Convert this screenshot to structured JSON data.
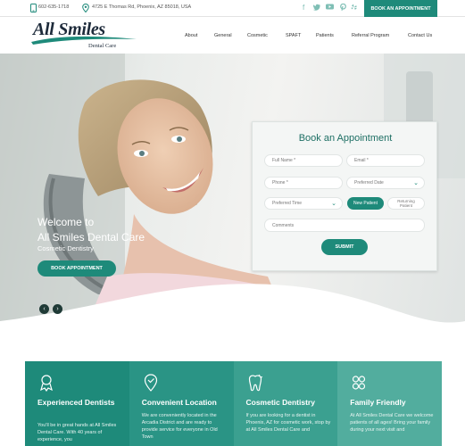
{
  "topbar": {
    "phone": "602-635-1718",
    "address": "4725 E Thomas Rd, Phoenix, AZ 85018, USA",
    "social_icons": [
      "facebook-icon",
      "twitter-icon",
      "youtube-icon",
      "pinterest-icon",
      "yelp-icon"
    ],
    "book_label": "BOOK AN APPOINTMENT"
  },
  "logo": {
    "main": "All Smiles",
    "sub": "Dental Care"
  },
  "nav": [
    "About",
    "General",
    "Cosmetic",
    "SPAFT",
    "Patients",
    "Referral Program",
    "Contact Us"
  ],
  "hero": {
    "line1": "Welcome to",
    "line2": "All Smiles Dental Care",
    "tagline": "Cosmetic Dentistry",
    "button": "BOOK APPOINTMENT",
    "prev": "‹",
    "next": "›"
  },
  "form": {
    "title": "Book an Appointment",
    "full_name": "Full Name *",
    "email": "Email *",
    "phone": "Phone *",
    "preferred_date": "Preferred Date",
    "preferred_time": "Preferred Time",
    "new_patient": "New Patient",
    "returning_patient": "Returning Patient",
    "comments": "Comments",
    "submit": "SUBMIT"
  },
  "features": [
    {
      "title": "Experienced Dentists",
      "body": "You'll be in great hands at All Smiles Dental Care. With 40 years of experience, you",
      "color": "#1e8a7a",
      "icon": "tooth-award-icon"
    },
    {
      "title": "Convenient Location",
      "body": "We are conveniently located in the Arcadia District and are ready to provide service for everyone in Old Town",
      "color": "#2a9485",
      "icon": "location-pin-icon"
    },
    {
      "title": "Cosmetic Dentistry",
      "body": "If you are looking for a dentist in Phoenix, AZ for cosmetic work, stop by at All Smiles Dental Care and",
      "color": "#3ba090",
      "icon": "tooth-icon"
    },
    {
      "title": "Family Friendly",
      "body": "At All Smiles Dental Care we welcome patients of all ages! Bring your family during your next visit and",
      "color": "#52ad9e",
      "icon": "family-icon"
    }
  ]
}
